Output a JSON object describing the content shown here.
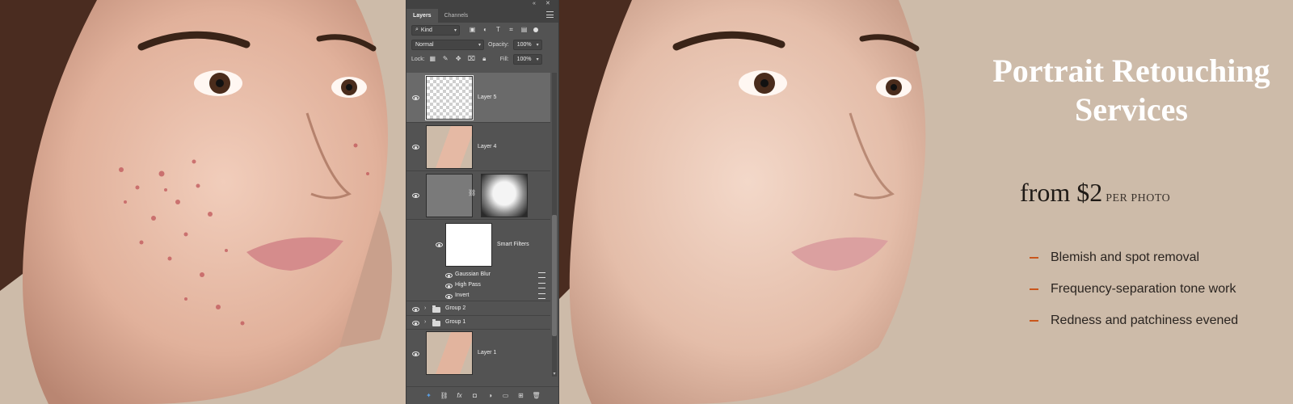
{
  "panel": {
    "tabs": [
      {
        "label": "Layers",
        "active": true
      },
      {
        "label": "Channels",
        "active": false
      }
    ],
    "filter_label": "Kind",
    "blend_mode": "Normal",
    "opacity_label": "Opacity:",
    "opacity_value": "100%",
    "lock_label": "Lock:",
    "fill_label": "Fill:",
    "fill_value": "100%",
    "layers": {
      "layer5": "Layer 5",
      "layer4": "Layer 4",
      "smart_filters": "Smart Filters",
      "gaussian_blur": "Gaussian Blur",
      "high_pass": "High Pass",
      "invert": "Invert",
      "group2": "Group 2",
      "group1": "Group 1",
      "layer1": "Layer 1"
    }
  },
  "promo": {
    "headline_line1": "Portrait Retouching",
    "headline_line2": "Services",
    "price_from": "from $2",
    "price_unit": "PER PHOTO",
    "bullets": [
      "Blemish and spot removal",
      "Frequency-separation tone work",
      "Redness and patchiness evened"
    ]
  },
  "colors": {
    "background": "#cdbba9",
    "panel": "#535353",
    "accent": "#c9561c",
    "headline": "#ffffff"
  }
}
